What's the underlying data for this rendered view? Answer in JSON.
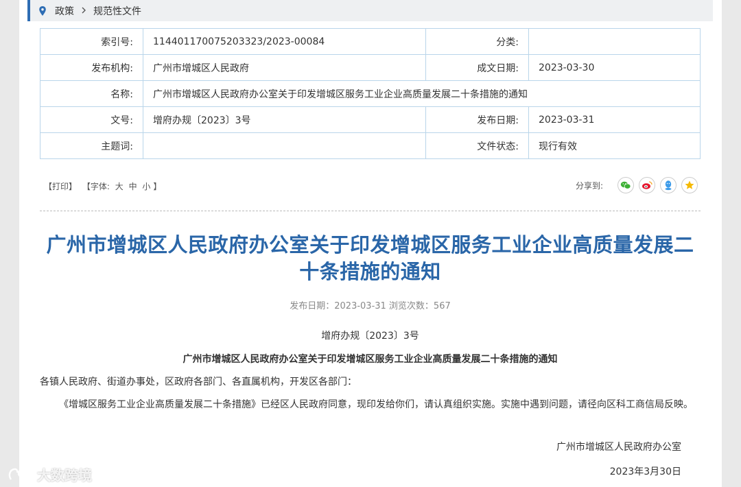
{
  "breadcrumb": {
    "items": [
      "政策",
      "规范性文件"
    ]
  },
  "meta": {
    "index_label": "索引号:",
    "index_value": "114401170075203323/2023-00084",
    "category_label": "分类:",
    "category_value": "",
    "issuer_label": "发布机构:",
    "issuer_value": "广州市增城区人民政府",
    "written_date_label": "成文日期:",
    "written_date_value": "2023-03-30",
    "name_label": "名称:",
    "name_value": "广州市增城区人民政府办公室关于印发增城区服务工业企业高质量发展二十条措施的通知",
    "doc_no_label": "文号:",
    "doc_no_value": "增府办规〔2023〕3号",
    "publish_date_label": "发布日期:",
    "publish_date_value": "2023-03-31",
    "subject_label": "主题词:",
    "subject_value": "",
    "status_label": "文件状态:",
    "status_value": "现行有效"
  },
  "tools": {
    "print": "【打印】",
    "font_prefix": "【字体:",
    "font_large": "大",
    "font_medium": "中",
    "font_small": "小",
    "font_suffix": "】",
    "share_label": "分享到:",
    "share_icons": [
      "wechat-icon",
      "weibo-icon",
      "qq-icon",
      "qzone-icon"
    ],
    "share_colors": {
      "wechat": "#3cb034",
      "weibo": "#e6162d",
      "qq": "#3d9be9",
      "qzone": "#f5b900"
    }
  },
  "article": {
    "title": "广州市增城区人民政府办公室关于印发增城区服务工业企业高质量发展二十条措施的通知",
    "publish_info": "发布日期：2023-03-31  浏览次数：567",
    "doc_no": "增府办规〔2023〕3号",
    "subtitle": "广州市增城区人民政府办公室关于印发增城区服务工业企业高质量发展二十条措施的通知",
    "addressee": "各镇人民政府、街道办事处，区政府各部门、各直属机构，开发区各部门：",
    "body": "《增城区服务工业企业高质量发展二十条措施》已经区人民政府同意，现印发给你们，请认真组织实施。实施中遇到问题，请径向区科工商信局反映。",
    "signer": "广州市增城区人民政府办公室",
    "date": "2023年3月30日"
  },
  "watermark": {
    "text": "大数跨境"
  },
  "colors": {
    "accent": "#2a66a8",
    "border": "#b9d5ea",
    "breadcrumb_bar": "#2e6db4"
  }
}
